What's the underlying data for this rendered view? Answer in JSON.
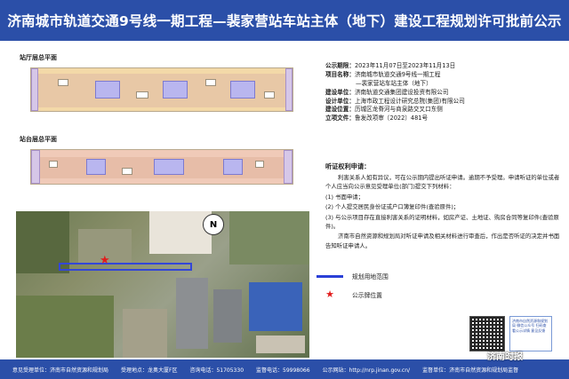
{
  "title": "济南城市轨道交通9号线一期工程—裴家营站车站主体（地下）建设工程规划许可批前公示",
  "sections": {
    "hall_plan_label": "站厅层总平面",
    "platform_plan_label": "站台层总平面"
  },
  "info": {
    "period": {
      "key": "公示期限：",
      "value": "2023年11月07日至2023年11月13日"
    },
    "project": {
      "key": "项目名称：",
      "value": "济南城市轨道交通9号线一期工程",
      "value2": "—裴家营站车站主体（地下）"
    },
    "builder": {
      "key": "建设单位：",
      "value": "济南轨道交通集团建设投资有限公司"
    },
    "designer": {
      "key": "设计单位：",
      "value": "上海市政工程设计研究总院(集团)有限公司"
    },
    "location": {
      "key": "建设位置：",
      "value": "历城区龙脊河与商泉路交叉口东侧"
    },
    "approval": {
      "key": "立项文件：",
      "value": "鲁发改项审〔2022〕481号"
    }
  },
  "hearing": {
    "title": "听证权利申请：",
    "paragraphs": [
      "利害关系人如有异议，可在公示期内提出听证申请。逾期不予受理。申请听证的单位或者个人应当向公示意见受理单位(部门)提交下列材料：",
      "(1) 书面申请；",
      "(2) 个人提交居民身份证或户口簿复印件(查验原件)；",
      "(3) 与公示项目存在直接利害关系的证明材料，如房产证、土地证、购房合同等复印件(查验原件)。",
      "济南市自然资源和规划局对听证申请及相关材料进行审查后，作出是否听证的决定并书面告知听证申请人。"
    ]
  },
  "legend": {
    "boundary_label": "规划用地范围",
    "notice_label": "公示牌位置"
  },
  "map": {
    "north_label": "N"
  },
  "qr_note": "济南市自然资源和规划局 微信公众号 扫码查看公示详情 意见反馈",
  "footer": {
    "unit": "意见受理单位：济南市自然资源和规划局",
    "address": "受理地点：龙奥大厦F区",
    "phone1": "咨询电话：51705330",
    "phone2": "监督电话：59998066",
    "site": "公示网站：http://nrp.jinan.gov.cn/",
    "monitor": "监督单位：济南市自然资源和规划局监督"
  },
  "watermark": "济南时报",
  "colors": {
    "header": "#2b4fa8",
    "boundary": "#2a3fd6",
    "marker": "#e21c1c"
  }
}
